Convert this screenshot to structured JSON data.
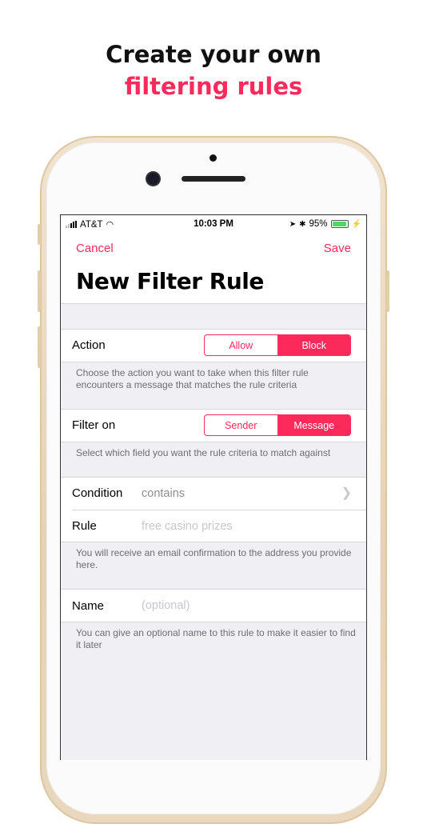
{
  "promo": {
    "line1": "Create your own",
    "line2": "filtering rules"
  },
  "status": {
    "carrier": "AT&T",
    "time": "10:03 PM",
    "battery": "95%",
    "battery_level": 0.95
  },
  "nav": {
    "cancel": "Cancel",
    "save": "Save",
    "title": "New Filter Rule"
  },
  "action": {
    "label": "Action",
    "options": [
      "Allow",
      "Block"
    ],
    "selected": "Block",
    "note": "Choose the action you want to take when this filter rule encounters a message that matches the rule criteria"
  },
  "filter_on": {
    "label": "Filter on",
    "options": [
      "Sender",
      "Message"
    ],
    "selected": "Message",
    "note": "Select which field you want the rule criteria to match against"
  },
  "condition": {
    "label": "Condition",
    "value": "contains"
  },
  "rule": {
    "label": "Rule",
    "placeholder": "free casino prizes",
    "note": "You will receive an email confirmation to the address you provide here."
  },
  "name": {
    "label": "Name",
    "placeholder": "(optional)",
    "note": "You can give an optional name to this rule to make it easier to find it later"
  },
  "colors": {
    "accent": "#fb2a5a",
    "phone_gold": "#e6d2b5"
  }
}
